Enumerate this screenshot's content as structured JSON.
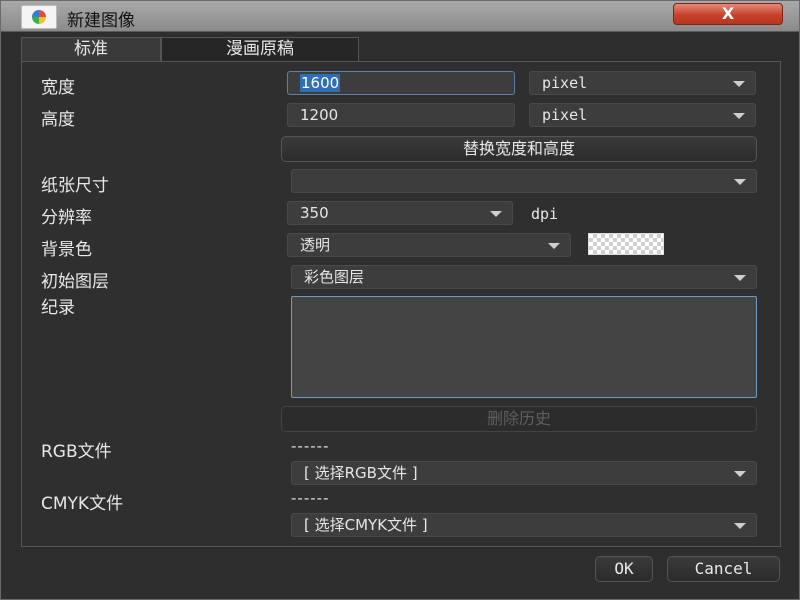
{
  "window": {
    "title": "新建图像",
    "close_label": "X"
  },
  "tabs": [
    {
      "label": "标准"
    },
    {
      "label": "漫画原稿"
    }
  ],
  "form": {
    "width_label": "宽度",
    "width_value": "1600",
    "width_unit": "pixel",
    "height_label": "高度",
    "height_value": "1200",
    "height_unit": "pixel",
    "swap_button": "替换宽度和高度",
    "paper_size_label": "纸张尺寸",
    "paper_size_value": "",
    "resolution_label": "分辨率",
    "resolution_value": "350",
    "resolution_unit": "dpi",
    "background_label": "背景色",
    "background_value": "透明",
    "initial_layer_label": "初始图层",
    "initial_layer_value": "彩色图层",
    "notes_label": "纪录",
    "delete_history_button": "删除历史",
    "rgb_file_label": "RGB文件",
    "rgb_file_dashes": "------",
    "rgb_file_select": "[ 选择RGB文件 ]",
    "cmyk_file_label": "CMYK文件",
    "cmyk_file_dashes": "------",
    "cmyk_file_select": "[ 选择CMYK文件 ]"
  },
  "footer": {
    "ok_label": "OK",
    "cancel_label": "Cancel"
  },
  "colors": {
    "accent": "#2f6fb5",
    "close_button": "#c8422b",
    "background": "#2e2e2e"
  },
  "icons": [
    "app-icon",
    "close-icon",
    "dropdown-arrow-icon"
  ]
}
